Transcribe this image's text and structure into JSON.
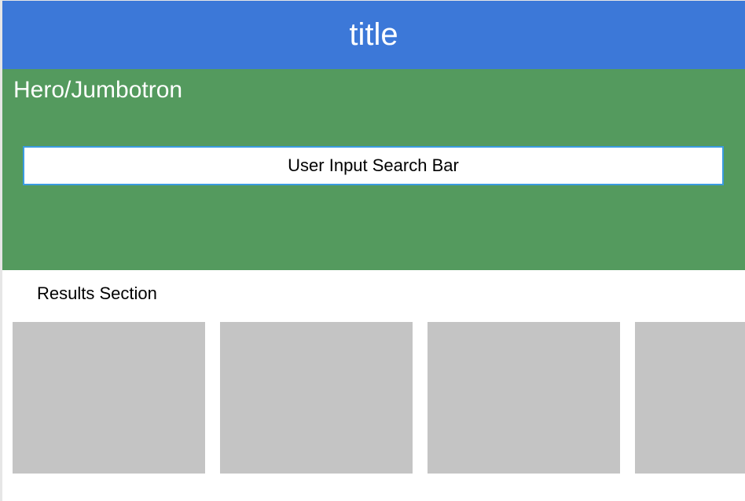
{
  "header": {
    "title": "title",
    "color": "#3c78d8"
  },
  "hero": {
    "label": "Hero/Jumbotron",
    "color": "#549a5e",
    "search": {
      "placeholder": "User Input Search Bar",
      "border_color": "#3b9be0"
    }
  },
  "results": {
    "label": "Results Section",
    "card_color": "#c4c4c4",
    "cards": [
      {
        "id": "result-card-1"
      },
      {
        "id": "result-card-2"
      },
      {
        "id": "result-card-3"
      },
      {
        "id": "result-card-4"
      }
    ]
  }
}
